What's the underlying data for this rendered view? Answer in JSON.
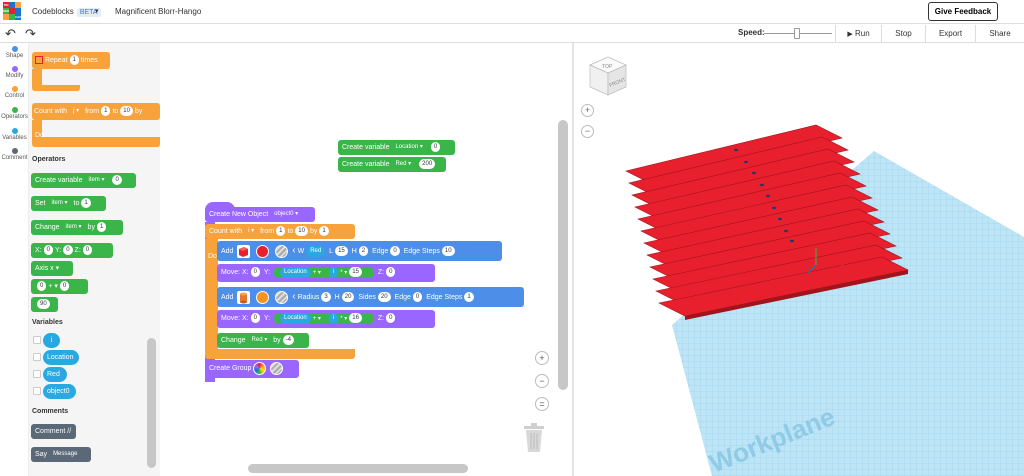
{
  "topbar": {
    "logo_letters": [
      "TIN",
      "KER",
      "CAD"
    ],
    "app_name": "Codeblocks",
    "beta": "BETA",
    "project_name": "Magnificent Blorr-Hango",
    "feedback": "Give Feedback"
  },
  "toolbar": {
    "speed_label": "Speed:",
    "run": "Run",
    "stop": "Stop",
    "export": "Export",
    "share": "Share",
    "run_icon": "▶"
  },
  "categories": [
    {
      "label": "Shape",
      "color": "#4c8ee8"
    },
    {
      "label": "Modify",
      "color": "#9966ff"
    },
    {
      "label": "Control",
      "color": "#f7a23b"
    },
    {
      "label": "Operators",
      "color": "#3ab54a"
    },
    {
      "label": "Variables",
      "color": "#29a9e1"
    },
    {
      "label": "Comment",
      "color": "#5b6878"
    }
  ],
  "palette": {
    "repeat": "Repeat",
    "repeat_n": "1",
    "times": "times",
    "count_with": "Count with",
    "count_var": "j ▾",
    "from": "from",
    "from_v": "1",
    "to": "to",
    "to_v": "10",
    "by": "by",
    "do": "Do",
    "operators_title": "Operators",
    "create_variable": "Create variable",
    "cv_var": "item ▾",
    "cv_val": "0",
    "set": "Set",
    "set_var": "item ▾",
    "set_to": "to",
    "set_val": "1",
    "change": "Change",
    "change_var": "item ▾",
    "change_by": "by",
    "change_val": "1",
    "x_lbl": "X:",
    "x_val": "0",
    "y_lbl": "Y:",
    "y_val": "0",
    "z_lbl": "Z:",
    "z_val": "0",
    "axis": "Axis x ▾",
    "math_a": "0",
    "math_op": "+ ▾",
    "math_b": "0",
    "angle": "90",
    "variables_title": "Variables",
    "vars": [
      "i",
      "Location",
      "Red",
      "object0"
    ],
    "comments_title": "Comments",
    "comment": "Comment //",
    "say": "Say",
    "say_msg": "Message"
  },
  "script": {
    "cv1": "Create variable",
    "cv1_var": "Location ▾",
    "cv1_val": "0",
    "cv2": "Create variable",
    "cv2_var": "Red ▾",
    "cv2_val": "200",
    "create_obj": "Create New Object",
    "create_obj_var": "object0 ▾",
    "count_with": "Count with",
    "count_var": "i ▾",
    "from": "from",
    "from_v": "1",
    "to": "to",
    "to_v": "10",
    "by": "by",
    "by_v": "1",
    "do": "Do",
    "add1": "Add",
    "add1_w": "W",
    "add1_w_var": "Red",
    "add1_l": "L",
    "add1_l_v": "15",
    "add1_h": "H",
    "add1_h_v": "2",
    "add1_edge": "Edge",
    "add1_edge_v": "0",
    "add1_steps": "Edge Steps",
    "add1_steps_v": "10",
    "move1": "Move:",
    "m1_x": "X:",
    "m1_xv": "0",
    "m1_y": "Y:",
    "m1_loc": "Location",
    "m1_op": "+ ▾",
    "m1_i": "i",
    "m1_op2": "* ▾",
    "m1_n": "15",
    "m1_z": "Z:",
    "m1_zv": "0",
    "add2": "Add",
    "add2_r": "Radius",
    "add2_r_v": "3",
    "add2_h": "H",
    "add2_h_v": "20",
    "add2_sides": "Sides",
    "add2_sides_v": "20",
    "add2_edge": "Edge",
    "add2_edge_v": "0",
    "add2_steps": "Edge Steps",
    "add2_steps_v": "1",
    "move2": "Move:",
    "m2_x": "X:",
    "m2_xv": "0",
    "m2_y": "Y:",
    "m2_loc": "Location",
    "m2_op": "+ ▾",
    "m2_i": "i",
    "m2_op2": "* ▾",
    "m2_n": "16",
    "m2_z": "Z:",
    "m2_zv": "0",
    "change": "Change",
    "change_var": "Red ▾",
    "change_by": "by",
    "change_v": "-4",
    "create_group": "Create Group"
  },
  "viewport": {
    "workplane": "Workplane",
    "cube_top": "TOP",
    "cube_front": "FRONT",
    "plank_color": "#e8202e",
    "grid_color": "#a9d8f0"
  }
}
